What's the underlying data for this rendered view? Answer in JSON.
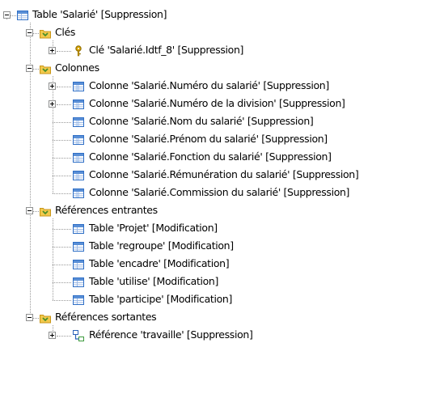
{
  "tree": {
    "root": {
      "label": "Table 'Salarié' [Suppression]",
      "icon": "table-icon",
      "expanded": true
    },
    "groups": [
      {
        "label": "Clés",
        "icon": "folder-icon",
        "expanded": true,
        "children": [
          {
            "label": "Clé 'Salarié.Idtf_8' [Suppression]",
            "icon": "key-icon",
            "expandable": true
          }
        ]
      },
      {
        "label": "Colonnes",
        "icon": "folder-icon",
        "expanded": true,
        "children": [
          {
            "label": "Colonne 'Salarié.Numéro du salarié' [Suppression]",
            "icon": "column-icon",
            "expandable": true
          },
          {
            "label": "Colonne 'Salarié.Numéro de la division' [Suppression]",
            "icon": "column-icon",
            "expandable": true
          },
          {
            "label": "Colonne 'Salarié.Nom du salarié' [Suppression]",
            "icon": "column-icon",
            "expandable": false
          },
          {
            "label": "Colonne 'Salarié.Prénom du salarié' [Suppression]",
            "icon": "column-icon",
            "expandable": false
          },
          {
            "label": "Colonne 'Salarié.Fonction du salarié' [Suppression]",
            "icon": "column-icon",
            "expandable": false
          },
          {
            "label": "Colonne 'Salarié.Rémunération du salarié' [Suppression]",
            "icon": "column-icon",
            "expandable": false
          },
          {
            "label": "Colonne 'Salarié.Commission du salarié' [Suppression]",
            "icon": "column-icon",
            "expandable": false
          }
        ]
      },
      {
        "label": "Références entrantes",
        "icon": "folder-icon",
        "expanded": true,
        "children": [
          {
            "label": "Table 'Projet' [Modification]",
            "icon": "table-icon",
            "expandable": false
          },
          {
            "label": "Table 'regroupe' [Modification]",
            "icon": "table-icon",
            "expandable": false
          },
          {
            "label": "Table 'encadre' [Modification]",
            "icon": "table-icon",
            "expandable": false
          },
          {
            "label": "Table 'utilise' [Modification]",
            "icon": "table-icon",
            "expandable": false
          },
          {
            "label": "Table 'participe' [Modification]",
            "icon": "table-icon",
            "expandable": false
          }
        ]
      },
      {
        "label": "Références sortantes",
        "icon": "folder-icon",
        "expanded": true,
        "children": [
          {
            "label": "Référence 'travaille' [Suppression]",
            "icon": "reference-icon",
            "expandable": true
          }
        ]
      }
    ]
  },
  "colors": {
    "table_blue": "#2f6fc6",
    "table_header": "#5a8fd6",
    "folder_yellow": "#f2c94c",
    "folder_dark": "#c9961a",
    "folder_arrow": "#4a8f2a",
    "key_gold": "#d9a400",
    "reference_blue": "#2b62b8",
    "reference_green": "#3c9a3c"
  }
}
